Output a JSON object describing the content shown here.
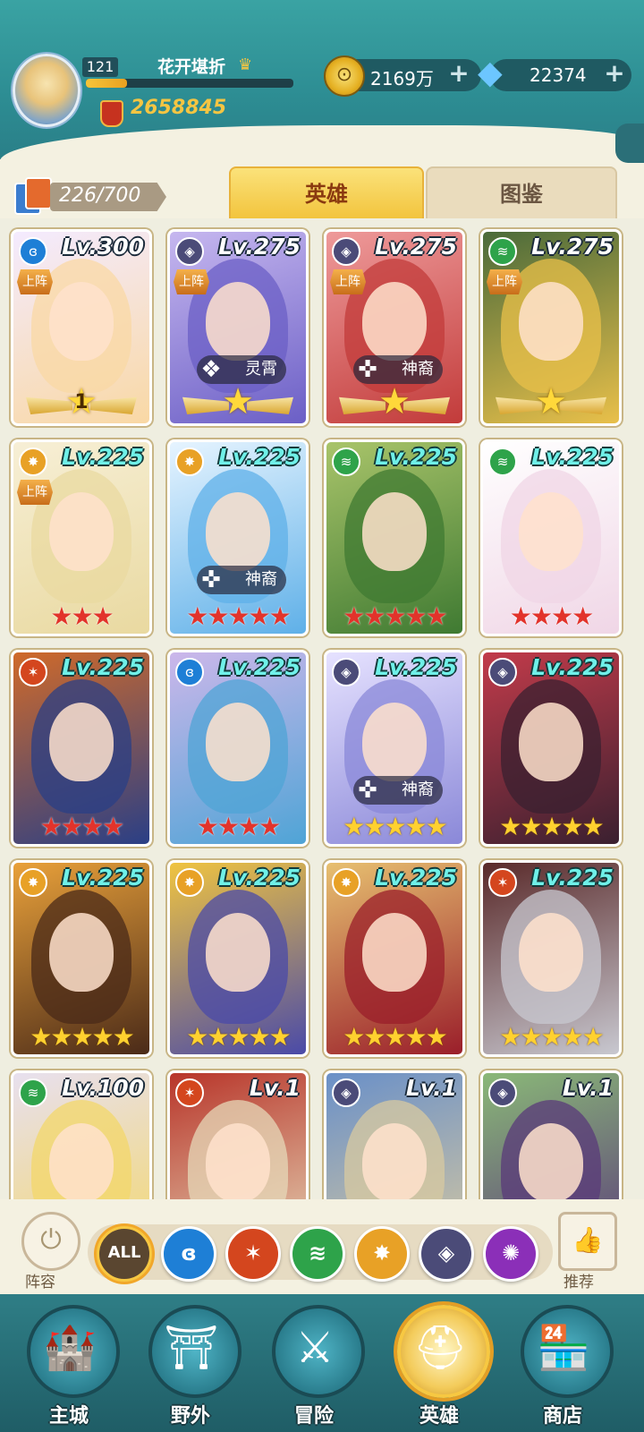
{
  "player": {
    "level": "121",
    "name": "花开堪折",
    "exp_progress": 0.2,
    "power": "2658845"
  },
  "resources": {
    "gold": "2169万",
    "diamonds": "22374"
  },
  "hero_count": "226/700",
  "tabs": [
    {
      "label": "英雄",
      "active": true
    },
    {
      "label": "图鉴",
      "active": false
    }
  ],
  "faction_colors": {
    "water": "#1e7fd6",
    "fire": "#d4461e",
    "wind": "#2ea34a",
    "light": "#e8a126",
    "dark": "#4b4b78",
    "void": "#8b2fb8"
  },
  "deploy_label": "上阵",
  "heroes": [
    {
      "level": "Lv.300",
      "faction": "water",
      "deployed": true,
      "tag": "",
      "tag_icon": "",
      "rank_type": "wings",
      "rank_value": "1",
      "art_colors": [
        "#f9d8a4",
        "#f4ebff"
      ]
    },
    {
      "level": "Lv.275",
      "faction": "dark",
      "deployed": true,
      "tag": "灵霄",
      "tag_icon": "mask-icon",
      "rank_type": "wings",
      "rank_value": "",
      "art_colors": [
        "#6b5fc6",
        "#c6b7ef"
      ]
    },
    {
      "level": "Lv.275",
      "faction": "dark",
      "deployed": true,
      "tag": "神裔",
      "tag_icon": "divine-icon",
      "rank_type": "wings",
      "rank_value": "",
      "art_colors": [
        "#c23b3a",
        "#ee9a9a"
      ]
    },
    {
      "level": "Lv.275",
      "faction": "wind",
      "deployed": true,
      "tag": "",
      "tag_icon": "",
      "rank_type": "wings",
      "rank_value": "",
      "art_colors": [
        "#e9c04a",
        "#4a6a3a"
      ]
    },
    {
      "level": "Lv.225",
      "faction": "light",
      "deployed": true,
      "tag": "",
      "tag_icon": "",
      "rank_type": "red",
      "rank_value": 3,
      "art_colors": [
        "#e9d9a0",
        "#f7efd6"
      ]
    },
    {
      "level": "Lv.225",
      "faction": "light",
      "deployed": false,
      "tag": "神裔",
      "tag_icon": "divine-icon",
      "rank_type": "red",
      "rank_value": 5,
      "art_colors": [
        "#5fb0e8",
        "#e6f4ff"
      ]
    },
    {
      "level": "Lv.225",
      "faction": "wind",
      "deployed": false,
      "tag": "",
      "tag_icon": "",
      "rank_type": "red",
      "rank_value": 5,
      "art_colors": [
        "#3f7a32",
        "#a9c46a"
      ]
    },
    {
      "level": "Lv.225",
      "faction": "wind",
      "deployed": false,
      "tag": "",
      "tag_icon": "",
      "rank_type": "red",
      "rank_value": 4,
      "art_colors": [
        "#f0d6e6",
        "#ffffff"
      ]
    },
    {
      "level": "Lv.225",
      "faction": "fire",
      "deployed": false,
      "tag": "",
      "tag_icon": "",
      "rank_type": "red",
      "rank_value": 4,
      "art_colors": [
        "#2a3f86",
        "#d06a2a"
      ]
    },
    {
      "level": "Lv.225",
      "faction": "water",
      "deployed": false,
      "tag": "",
      "tag_icon": "",
      "rank_type": "red",
      "rank_value": 4,
      "art_colors": [
        "#4fa4d6",
        "#ccb7ea"
      ]
    },
    {
      "level": "Lv.225",
      "faction": "dark",
      "deployed": false,
      "tag": "神裔",
      "tag_icon": "divine-icon",
      "rank_type": "gold",
      "rank_value": 5,
      "art_colors": [
        "#8a88d8",
        "#e6e2ff"
      ]
    },
    {
      "level": "Lv.225",
      "faction": "dark",
      "deployed": false,
      "tag": "",
      "tag_icon": "",
      "rank_type": "gold",
      "rank_value": 5,
      "art_colors": [
        "#3a2030",
        "#c23b4a"
      ]
    },
    {
      "level": "Lv.225",
      "faction": "light",
      "deployed": false,
      "tag": "",
      "tag_icon": "",
      "rank_type": "gold",
      "rank_value": 5,
      "art_colors": [
        "#4a2a18",
        "#e9a13a"
      ]
    },
    {
      "level": "Lv.225",
      "faction": "light",
      "deployed": false,
      "tag": "",
      "tag_icon": "",
      "rank_type": "gold",
      "rank_value": 5,
      "art_colors": [
        "#4a4aa8",
        "#f0c440"
      ]
    },
    {
      "level": "Lv.225",
      "faction": "light",
      "deployed": false,
      "tag": "",
      "tag_icon": "",
      "rank_type": "gold",
      "rank_value": 5,
      "art_colors": [
        "#9a1e2a",
        "#e7c070"
      ]
    },
    {
      "level": "Lv.225",
      "faction": "fire",
      "deployed": false,
      "tag": "",
      "tag_icon": "",
      "rank_type": "gold",
      "rank_value": 5,
      "art_colors": [
        "#c8c8d0",
        "#5a2a2a"
      ]
    },
    {
      "level": "Lv.100",
      "faction": "wind",
      "deployed": false,
      "tag": "",
      "tag_icon": "",
      "rank_type": "none",
      "rank_value": 0,
      "art_colors": [
        "#f3d76a",
        "#e8e0ef"
      ]
    },
    {
      "level": "Lv.1",
      "faction": "fire",
      "deployed": false,
      "tag": "",
      "tag_icon": "",
      "rank_type": "none",
      "rank_value": 0,
      "art_colors": [
        "#e6d8b8",
        "#b8352a"
      ]
    },
    {
      "level": "Lv.1",
      "faction": "dark",
      "deployed": false,
      "tag": "",
      "tag_icon": "",
      "rank_type": "none",
      "rank_value": 0,
      "art_colors": [
        "#d8c9a0",
        "#6a90c8"
      ]
    },
    {
      "level": "Lv.1",
      "faction": "dark",
      "deployed": false,
      "tag": "",
      "tag_icon": "",
      "rank_type": "none",
      "rank_value": 0,
      "art_colors": [
        "#5a3a7a",
        "#8ab878"
      ]
    }
  ],
  "filters": {
    "lineup_label": "阵容",
    "recommend_label": "推荐",
    "all_label": "ALL",
    "factions": [
      {
        "name": "water",
        "glyph": "ɞ"
      },
      {
        "name": "fire",
        "glyph": "✶"
      },
      {
        "name": "wind",
        "glyph": "≋"
      },
      {
        "name": "light",
        "glyph": "✸"
      },
      {
        "name": "dark",
        "glyph": "◈"
      },
      {
        "name": "void",
        "glyph": "✺"
      }
    ]
  },
  "bottom_nav": [
    {
      "label": "主城",
      "icon": "castle-icon",
      "glyph": "🏰",
      "active": false
    },
    {
      "label": "野外",
      "icon": "portal-icon",
      "glyph": "⛩",
      "active": false
    },
    {
      "label": "冒险",
      "icon": "sword-icon",
      "glyph": "⚔",
      "active": false
    },
    {
      "label": "英雄",
      "icon": "helmet-icon",
      "glyph": "⛑",
      "active": true
    },
    {
      "label": "商店",
      "icon": "shop-icon",
      "glyph": "🏪",
      "active": false
    }
  ]
}
